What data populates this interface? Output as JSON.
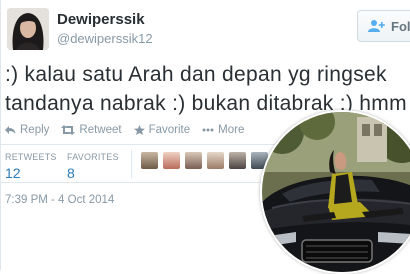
{
  "user": {
    "display_name": "Dewiperssik",
    "handle": "@dewiperssik12",
    "avatar_icon": "profile-photo"
  },
  "follow": {
    "label": "Follo",
    "icon": "add-user-icon"
  },
  "tweet": {
    "lines": [
      ":) kalau satu Arah dan depan yg ringsek",
      "tandanya nabrak :) bukan ditabrak :) hmm"
    ]
  },
  "actions": {
    "reply": "Reply",
    "retweet": "Retweet",
    "favorite": "Favorite",
    "more": "More"
  },
  "stats": {
    "retweets_label": "RETWEETS",
    "retweets_value": "12",
    "favorites_label": "FAVORITES",
    "favorites_value": "8"
  },
  "timestamp": "7:39 PM - 4 Oct 2014",
  "colors": {
    "text": "#292f33",
    "muted": "#8899a6",
    "link": "#2b7bb9",
    "border": "#e1e8ed"
  }
}
